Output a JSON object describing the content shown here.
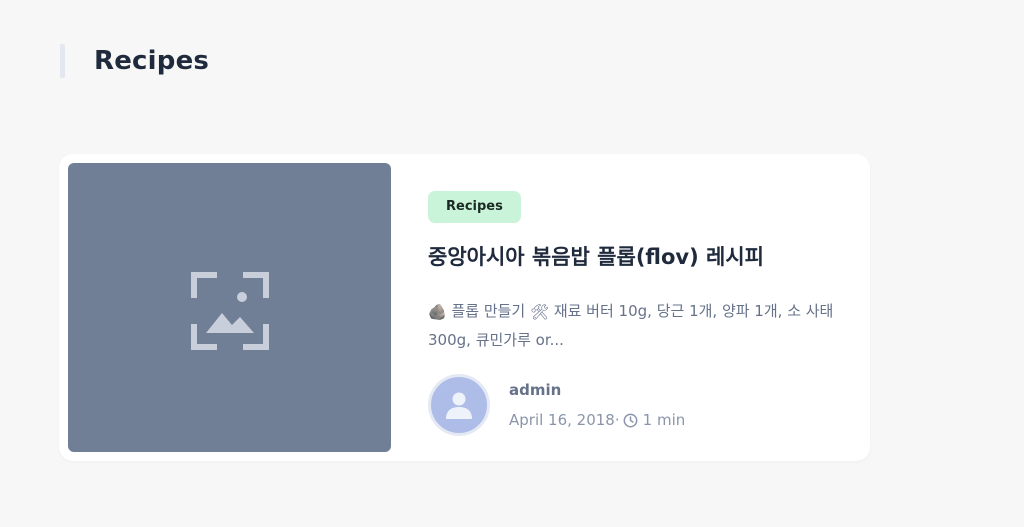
{
  "section": {
    "title": "Recipes"
  },
  "post": {
    "category": "Recipes",
    "title": "중앙아시아 볶음밥 플롭(flov) 레시피",
    "excerpt": {
      "emoji1": "🪨",
      "part1": " 플롭 만들기 ",
      "emoji2": "🛠",
      "part2": " 재료 버터 10g, 당근 1개, 양파 1개, 소 사태 300g, 큐민가루 or..."
    },
    "author": "admin",
    "date": "April 16, 2018",
    "separator": "·",
    "read_time": "1 min",
    "thumbnail_icon": "image-placeholder-icon",
    "avatar_icon": "user-icon"
  },
  "colors": {
    "page_bg": "#f7f7f8",
    "thumbnail_bg": "#717f96",
    "badge_bg": "#c9f4d9",
    "avatar_bg": "#aebde8",
    "title_text": "#1f2a3c",
    "muted_text": "#66728a"
  }
}
